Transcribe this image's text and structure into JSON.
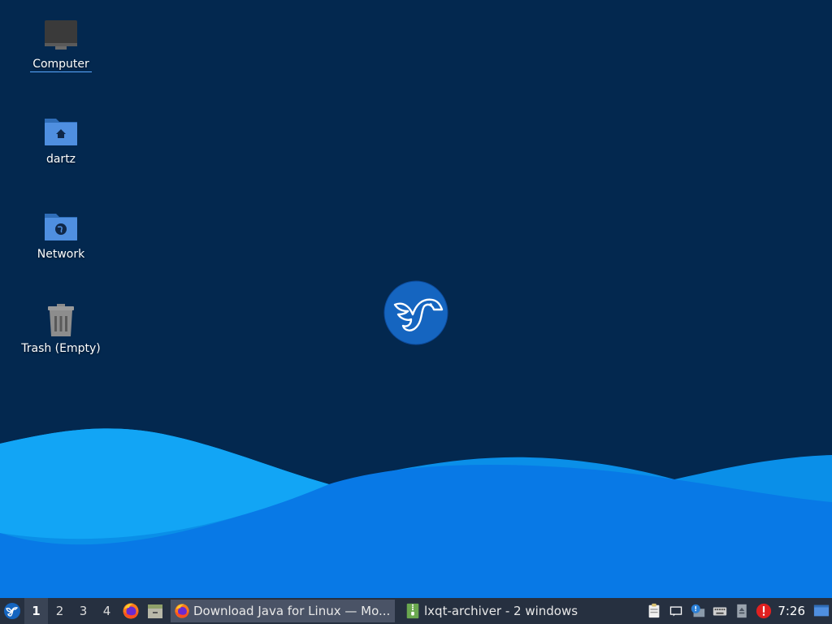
{
  "desktop": {
    "icons": [
      {
        "label": "Computer"
      },
      {
        "label": "dartz"
      },
      {
        "label": "Network"
      },
      {
        "label": "Trash (Empty)"
      }
    ]
  },
  "taskbar": {
    "workspaces": [
      "1",
      "2",
      "3",
      "4"
    ],
    "active_workspace": "1",
    "tasks": [
      {
        "label": "Download Java for Linux — Mo...",
        "icon": "firefox-icon"
      },
      {
        "label": "lxqt-archiver - 2 windows",
        "icon": "archive-icon"
      }
    ],
    "clock": "7:26"
  },
  "colors": {
    "desktop_bg": "#03284f",
    "wave_light": "#0ea2f2",
    "wave_dark": "#0879e6",
    "taskbar_bg": "#263040",
    "accent": "#1565c0"
  }
}
